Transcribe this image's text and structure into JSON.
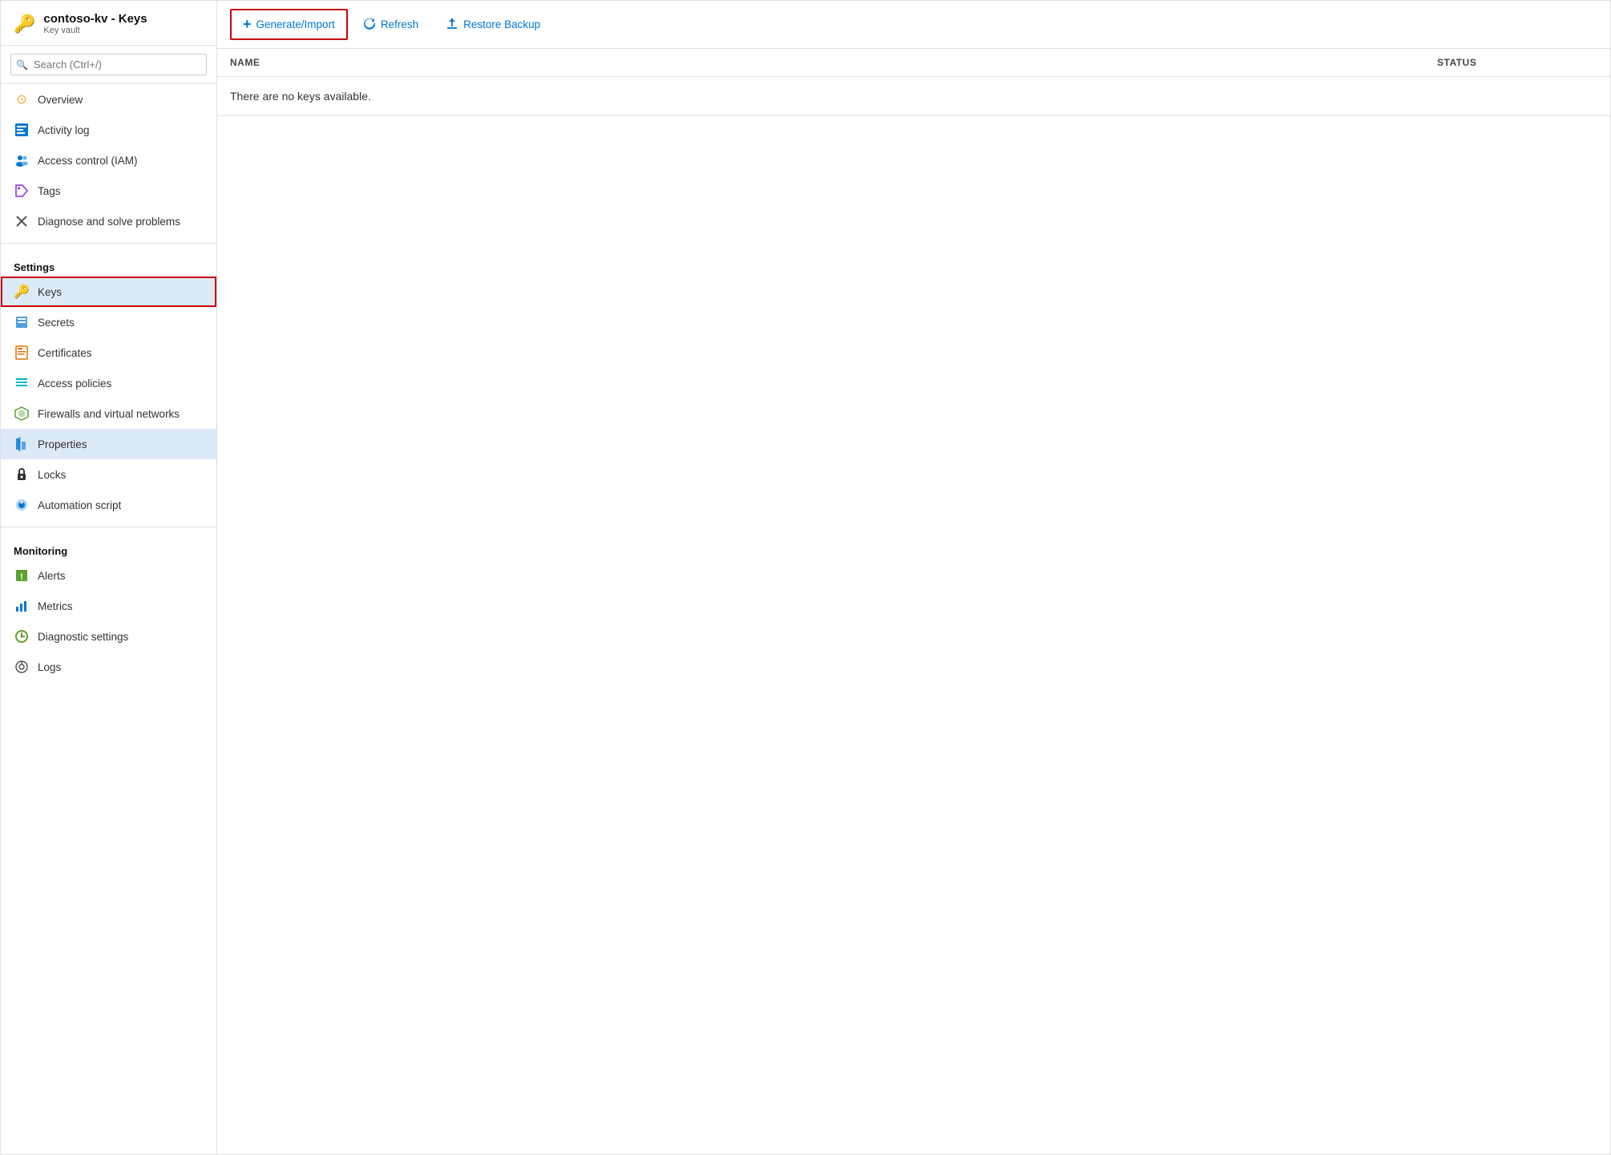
{
  "header": {
    "title": "contoso-kv - Keys",
    "subtitle": "Key vault",
    "icon": "🔑"
  },
  "sidebar": {
    "search_placeholder": "Search (Ctrl+/)",
    "collapse_label": "«",
    "nav_items": [
      {
        "id": "overview",
        "label": "Overview",
        "icon": "⊙",
        "icon_class": "icon-yellow",
        "section": null,
        "active": false
      },
      {
        "id": "activity-log",
        "label": "Activity log",
        "icon": "▦",
        "icon_class": "icon-blue",
        "section": null,
        "active": false
      },
      {
        "id": "access-control",
        "label": "Access control (IAM)",
        "icon": "👥",
        "icon_class": "icon-blue",
        "section": null,
        "active": false
      },
      {
        "id": "tags",
        "label": "Tags",
        "icon": "🏷",
        "icon_class": "icon-purple",
        "section": null,
        "active": false
      },
      {
        "id": "diagnose",
        "label": "Diagnose and solve problems",
        "icon": "✕",
        "icon_class": "icon-gray",
        "section": null,
        "active": false
      },
      {
        "id": "settings-label",
        "label": "Settings",
        "type": "section",
        "active": false
      },
      {
        "id": "keys",
        "label": "Keys",
        "icon": "🔑",
        "icon_class": "icon-yellow",
        "section": "Settings",
        "active": true,
        "outline": true
      },
      {
        "id": "secrets",
        "label": "Secrets",
        "icon": "🔲",
        "icon_class": "icon-blue",
        "section": "Settings",
        "active": false
      },
      {
        "id": "certificates",
        "label": "Certificates",
        "icon": "🗒",
        "icon_class": "icon-orange",
        "section": "Settings",
        "active": false
      },
      {
        "id": "access-policies",
        "label": "Access policies",
        "icon": "≡",
        "icon_class": "icon-teal",
        "section": "Settings",
        "active": false
      },
      {
        "id": "firewalls",
        "label": "Firewalls and virtual networks",
        "icon": "🔰",
        "icon_class": "icon-green",
        "section": "Settings",
        "active": false
      },
      {
        "id": "properties",
        "label": "Properties",
        "icon": "▤",
        "icon_class": "icon-blue",
        "section": "Settings",
        "active": false,
        "highlighted": true
      },
      {
        "id": "locks",
        "label": "Locks",
        "icon": "🔒",
        "icon_class": "icon-dark",
        "section": "Settings",
        "active": false
      },
      {
        "id": "automation-script",
        "label": "Automation script",
        "icon": "⬇",
        "icon_class": "icon-blue",
        "section": "Settings",
        "active": false
      },
      {
        "id": "monitoring-label",
        "label": "Monitoring",
        "type": "section",
        "active": false
      },
      {
        "id": "alerts",
        "label": "Alerts",
        "icon": "⚡",
        "icon_class": "icon-green",
        "section": "Monitoring",
        "active": false
      },
      {
        "id": "metrics",
        "label": "Metrics",
        "icon": "📊",
        "icon_class": "icon-blue",
        "section": "Monitoring",
        "active": false
      },
      {
        "id": "diagnostic-settings",
        "label": "Diagnostic settings",
        "icon": "⊕",
        "icon_class": "icon-green",
        "section": "Monitoring",
        "active": false
      },
      {
        "id": "logs",
        "label": "Logs",
        "icon": "🔍",
        "icon_class": "icon-gray",
        "section": "Monitoring",
        "active": false
      }
    ]
  },
  "toolbar": {
    "generate_import_label": "Generate/Import",
    "refresh_label": "Refresh",
    "restore_backup_label": "Restore Backup"
  },
  "table": {
    "col_name": "NAME",
    "col_status": "STATUS",
    "empty_message": "There are no keys available."
  }
}
